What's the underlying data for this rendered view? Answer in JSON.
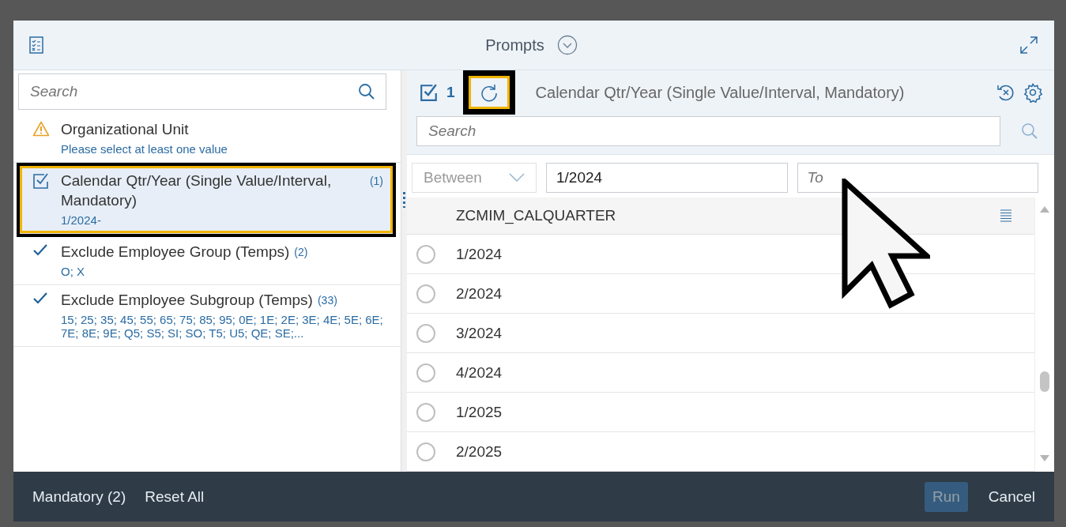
{
  "dialog": {
    "title": "Prompts"
  },
  "left": {
    "search": {
      "placeholder": "Search"
    },
    "prompts": [
      {
        "kind": "warning",
        "label": "Organizational Unit",
        "value": "Please select at least one value",
        "selected": false
      },
      {
        "kind": "edited",
        "label": "Calendar Qtr/Year (Single Value/Interval, Mandatory)",
        "count": "(1)",
        "value": "1/2024-",
        "selected": true
      },
      {
        "kind": "done",
        "label": "Exclude Employee Group (Temps)",
        "count": "(2)",
        "value": "O; X",
        "selected": false
      },
      {
        "kind": "done",
        "label": "Exclude Employee Subgroup (Temps)",
        "count": "(33)",
        "value": "15; 25; 35; 45; 55; 65; 75; 85; 95; 0E; 1E; 2E; 3E; 4E; 5E; 6E; 7E; 8E; 9E; Q5; S5; SI; SO; T5; U5; QE; SE;...",
        "selected": false
      }
    ]
  },
  "right": {
    "selected_count": "1",
    "refresh_button": {
      "highlighted": true
    },
    "title": "Calendar Qtr/Year (Single Value/Interval, Mandatory)",
    "search": {
      "placeholder": "Search"
    },
    "operator": "Between",
    "from": "1/2024",
    "to": {
      "placeholder": "To"
    },
    "column": "ZCMIM_CALQUARTER",
    "rows": [
      {
        "value": "1/2024",
        "selected": false
      },
      {
        "value": "2/2024",
        "selected": false
      },
      {
        "value": "3/2024",
        "selected": false
      },
      {
        "value": "4/2024",
        "selected": false
      },
      {
        "value": "1/2025",
        "selected": false
      },
      {
        "value": "2/2025",
        "selected": false
      }
    ]
  },
  "footer": {
    "buttons": [
      {
        "label": "Mandatory (2)",
        "kind": "link",
        "disabled": false
      },
      {
        "label": "Reset All",
        "kind": "link",
        "disabled": false
      },
      {
        "label": "Run",
        "kind": "primary",
        "disabled": true
      },
      {
        "label": "Cancel",
        "kind": "link",
        "disabled": false
      }
    ]
  }
}
